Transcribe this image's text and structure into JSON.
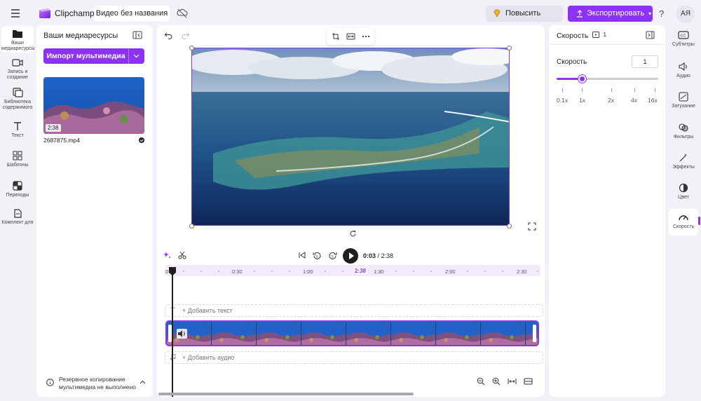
{
  "app": {
    "name": "Clipchamp",
    "project_title": "Видео без названия"
  },
  "topbar": {
    "upgrade_label": "Повысить статус",
    "export_label": "Экспортировать",
    "help": "?",
    "avatar": "АЯ"
  },
  "left_rail": [
    {
      "label": "Ваши медиаресурсы",
      "icon": "folder-icon",
      "active": true
    },
    {
      "label": "Запись и создание",
      "icon": "camera-icon"
    },
    {
      "label": "Библиотека содержимого",
      "icon": "library-icon"
    },
    {
      "label": "Текст",
      "icon": "text-icon"
    },
    {
      "label": "Шаблоны",
      "icon": "templates-icon"
    },
    {
      "label": "Переходы",
      "icon": "transitions-icon"
    },
    {
      "label": "Комплект для",
      "icon": "brand-kit-icon"
    }
  ],
  "media": {
    "title": "Ваши медиаресурсы",
    "import_label": "Импорт мультимедиа",
    "item": {
      "duration": "2:38",
      "filename": "2687875.mp4"
    },
    "backup_text": "Резервное копирование мультимедиа не выполнено"
  },
  "playback": {
    "current": "0:03",
    "total": "/ 2:38",
    "end_marker": "2:38"
  },
  "ruler_ticks": [
    "0",
    "0:30",
    "1:00",
    "1:30",
    "2:00",
    "2:30"
  ],
  "tracks": {
    "add_text": "+ Добавить текст",
    "add_audio": "+ Добавить аудио"
  },
  "properties": {
    "title": "Скорость",
    "badge": "1",
    "speed_label": "Скорость",
    "speed_value": "1",
    "slider_marks": [
      "0.1x",
      "1x",
      "2x",
      "4x",
      "16x"
    ]
  },
  "right_rail": [
    {
      "label": "Субтитры",
      "icon": "captions-icon"
    },
    {
      "label": "Аудио",
      "icon": "audio-icon"
    },
    {
      "label": "Затухание",
      "icon": "fade-icon"
    },
    {
      "label": "Фильтры",
      "icon": "filters-icon"
    },
    {
      "label": "Эффекты",
      "icon": "effects-icon"
    },
    {
      "label": "Цвет",
      "icon": "color-icon"
    },
    {
      "label": "Скорость",
      "icon": "speed-icon",
      "active": true
    }
  ],
  "colors": {
    "accent": "#8c32f5",
    "background": "#f3f1f8"
  }
}
